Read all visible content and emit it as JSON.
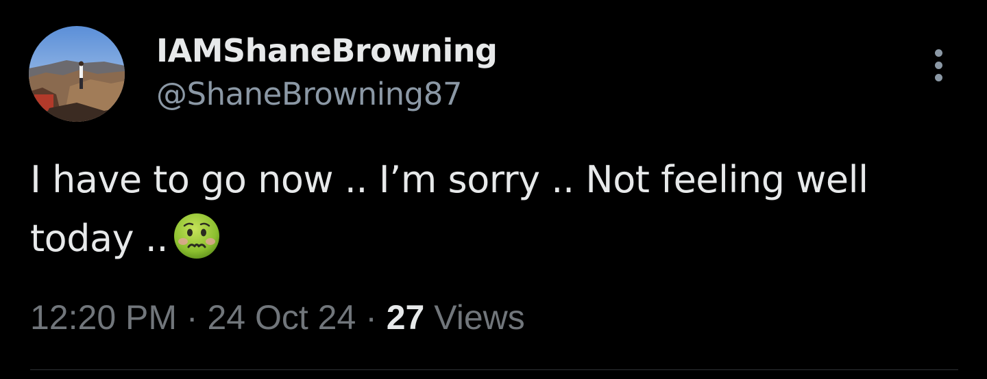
{
  "tweet": {
    "display_name": "IAMShaneBrowning",
    "handle": "@ShaneBrowning87",
    "text": "I have to go now .. I’m sorry .. Not feeling well today ..",
    "emoji": "nauseated-face",
    "time": "12:20 PM",
    "separator": "·",
    "date": "24 Oct 24",
    "views_count": "27",
    "views_label": "Views"
  },
  "colors": {
    "background": "#000000",
    "primary_text": "#e7e9ea",
    "secondary_text": "#71767b",
    "divider": "#2f3336"
  },
  "icons": {
    "more": "more-vertical-icon",
    "avatar": "profile-photo-canyon"
  }
}
